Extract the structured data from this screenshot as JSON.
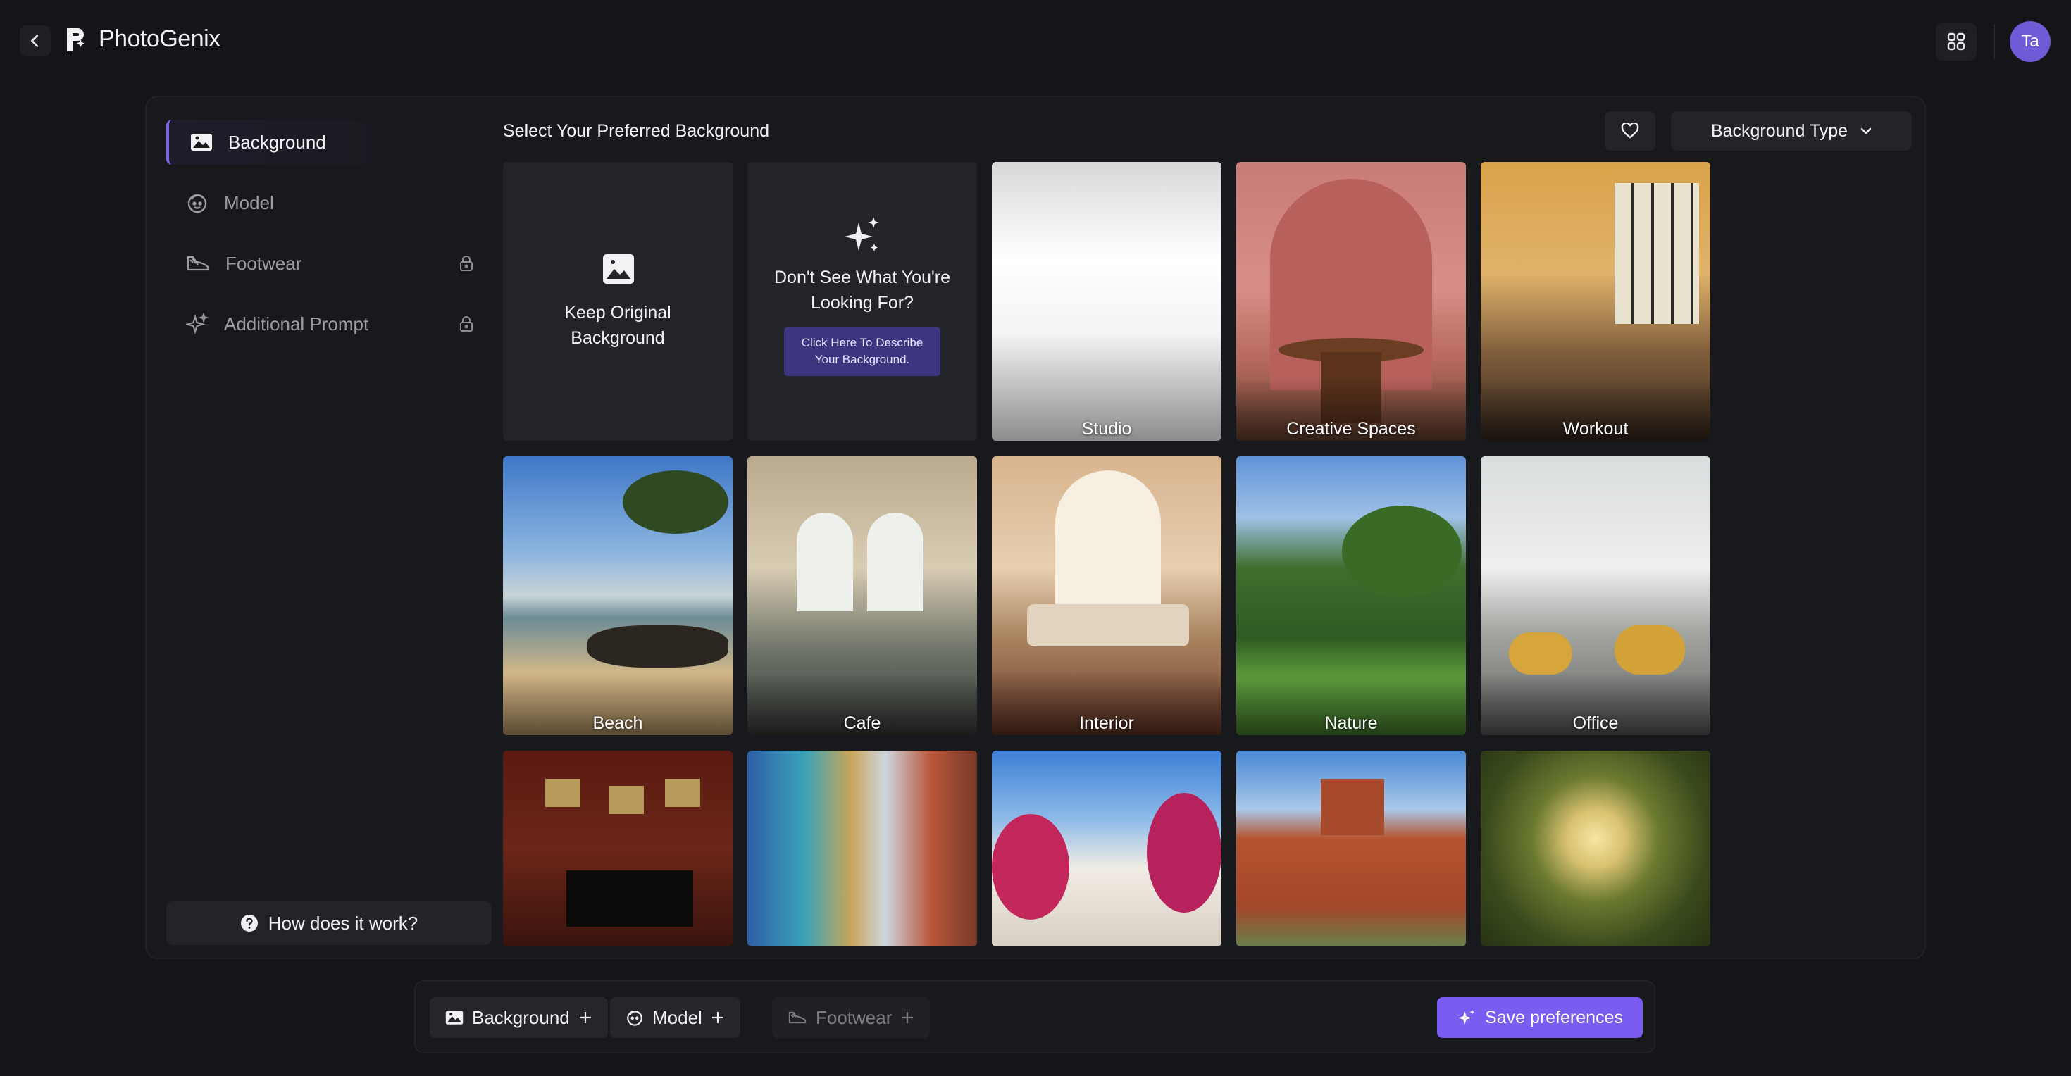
{
  "app": {
    "name": "PhotoGenix",
    "user_initials": "Ta"
  },
  "sidebar": {
    "items": [
      {
        "label": "Background",
        "icon": "image-icon",
        "active": true,
        "locked": false
      },
      {
        "label": "Model",
        "icon": "face-icon",
        "active": false,
        "locked": false
      },
      {
        "label": "Footwear",
        "icon": "shoe-icon",
        "active": false,
        "locked": true
      },
      {
        "label": "Additional Prompt",
        "icon": "sparkle-icon",
        "active": false,
        "locked": true
      }
    ],
    "help_label": "How does it work?"
  },
  "content": {
    "title": "Select Your Preferred Background",
    "type_dropdown": "Background Type",
    "keep_original": {
      "line1": "Keep Original",
      "line2": "Background"
    },
    "custom": {
      "line1": "Don't See What You're",
      "line2": "Looking For?",
      "button_line1": "Click Here To Describe",
      "button_line2": "Your Background."
    },
    "backgrounds": [
      {
        "label": "Studio"
      },
      {
        "label": "Creative Spaces"
      },
      {
        "label": "Workout"
      },
      {
        "label": "Beach"
      },
      {
        "label": "Cafe"
      },
      {
        "label": "Interior"
      },
      {
        "label": "Nature"
      },
      {
        "label": "Office"
      },
      {
        "label": ""
      },
      {
        "label": ""
      },
      {
        "label": ""
      },
      {
        "label": ""
      },
      {
        "label": ""
      }
    ]
  },
  "bottom": {
    "chips": [
      {
        "label": "Background",
        "icon": "image-icon",
        "enabled": true
      },
      {
        "label": "Model",
        "icon": "face-icon",
        "enabled": true
      },
      {
        "label": "Footwear",
        "icon": "shoe-icon",
        "enabled": false
      }
    ],
    "save_label": "Save preferences"
  },
  "colors": {
    "accent": "#7a5cf0",
    "background": "#141518",
    "panel": "#18191c"
  }
}
